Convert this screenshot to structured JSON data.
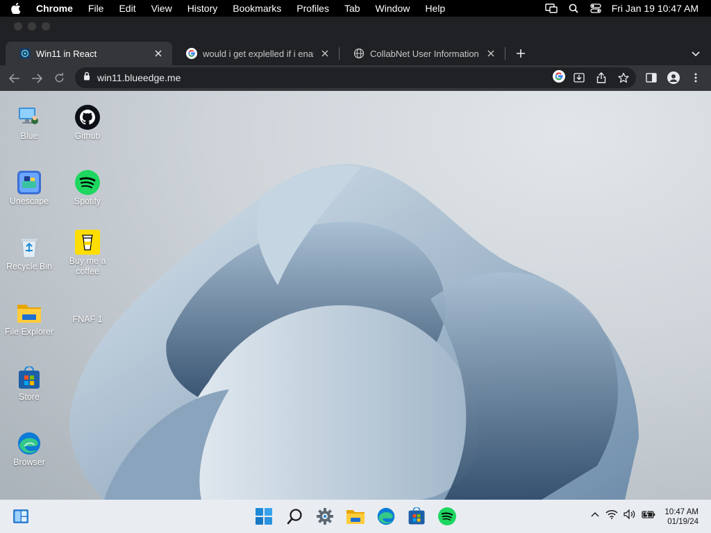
{
  "menubar": {
    "app": "Chrome",
    "items": [
      "File",
      "Edit",
      "View",
      "History",
      "Bookmarks",
      "Profiles",
      "Tab",
      "Window",
      "Help"
    ],
    "datetime": "Fri Jan 19  10:47 AM"
  },
  "tabs": [
    {
      "title": "Win11 in React",
      "favicon": "win11-react-icon",
      "active": true
    },
    {
      "title": "would i get explelled if i enable",
      "favicon": "google-icon",
      "active": false
    },
    {
      "title": "CollabNet User Information Ce",
      "favicon": "globe-icon",
      "active": false
    }
  ],
  "toolbar": {
    "url": "win11.blueedge.me"
  },
  "desktop": {
    "icons": [
      {
        "label": "Blue",
        "icon": "blue-pc-icon"
      },
      {
        "label": "Unescape",
        "icon": "unescape-icon"
      },
      {
        "label": "Recycle Bin",
        "icon": "recycle-bin-icon"
      },
      {
        "label": "File Explorer",
        "icon": "folder-icon"
      },
      {
        "label": "Store",
        "icon": "store-icon"
      },
      {
        "label": "Browser",
        "icon": "edge-icon"
      },
      {
        "label": "Github",
        "icon": "github-icon"
      },
      {
        "label": "Spotify",
        "icon": "spotify-icon"
      },
      {
        "label": "Buy me a coffee",
        "icon": "coffee-icon"
      },
      {
        "label": "FNAF 1",
        "icon": "fnaf-icon"
      }
    ]
  },
  "taskbar": {
    "apps": [
      "widgets-icon",
      "start-icon",
      "search-icon",
      "settings-icon",
      "file-explorer-icon",
      "edge-icon",
      "store-icon",
      "spotify-icon"
    ],
    "time": "10:47 AM",
    "date": "01/19/24"
  },
  "colors": {
    "chrome_dark": "#202124",
    "chrome_toolbar": "#35363a",
    "taskbar": "#e9edf2",
    "win_blue": "#1f86d6",
    "spotify_green": "#1ed760"
  }
}
